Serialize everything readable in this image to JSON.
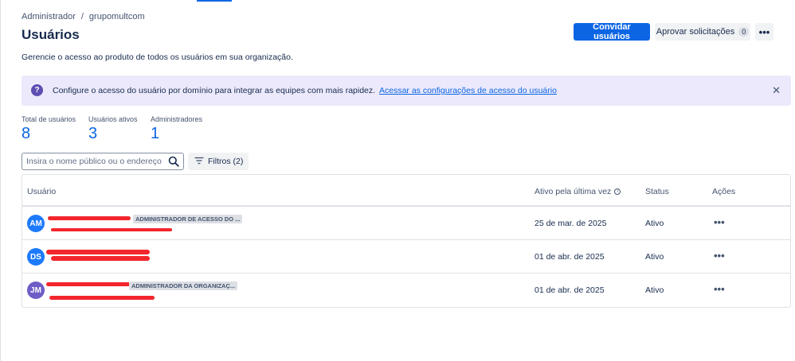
{
  "breadcrumb": {
    "items": [
      "Administrador",
      "/",
      "grupomultcom"
    ]
  },
  "page": {
    "title": "Usuários",
    "description": "Gerencie o acesso ao produto de todos os usuários em sua organização."
  },
  "header_actions": {
    "invite_label": "Convidar usuários",
    "approve_label": "Aprovar solicitações",
    "approve_count": "0",
    "more_label": "•••"
  },
  "banner": {
    "icon": "question-icon",
    "icon_glyph": "?",
    "text": "Configure o acesso do usuário por domínio para integrar as equipes com mais rapidez.",
    "link": "Acessar as configurações de acesso do usuário",
    "close": "✕"
  },
  "stats": [
    {
      "label": "Total de usuários",
      "value": "8"
    },
    {
      "label": "Usuários ativos",
      "value": "3"
    },
    {
      "label": "Administradores",
      "value": "1"
    }
  ],
  "search": {
    "placeholder": "Insira o nome público ou o endereço ..."
  },
  "filters": {
    "label": "Filtros (2)"
  },
  "table": {
    "columns": [
      "Usuário",
      "Ativo pela última vez",
      "Status",
      "Ações"
    ],
    "info_glyph": "i",
    "rows": [
      {
        "initials": "AM",
        "avatar_color": "#1d7afc",
        "role": "ADMINISTRADOR DE ACESSO DO ...",
        "last_active": "25 de mar. de 2025",
        "status": "Ativo",
        "actions": "•••"
      },
      {
        "initials": "DS",
        "avatar_color": "#1d7afc",
        "role": "",
        "last_active": "01 de abr. de 2025",
        "status": "Ativo",
        "actions": "•••"
      },
      {
        "initials": "JM",
        "avatar_color": "#6e5dc6",
        "role": "ADMINISTRADOR DA ORGANIZAÇ...",
        "last_active": "01 de abr. de 2025",
        "status": "Ativo",
        "actions": "•••"
      }
    ]
  },
  "colors": {
    "brand": "#0c66e4",
    "banner_bg": "#ece9fc",
    "redaction": "#f2262c"
  }
}
